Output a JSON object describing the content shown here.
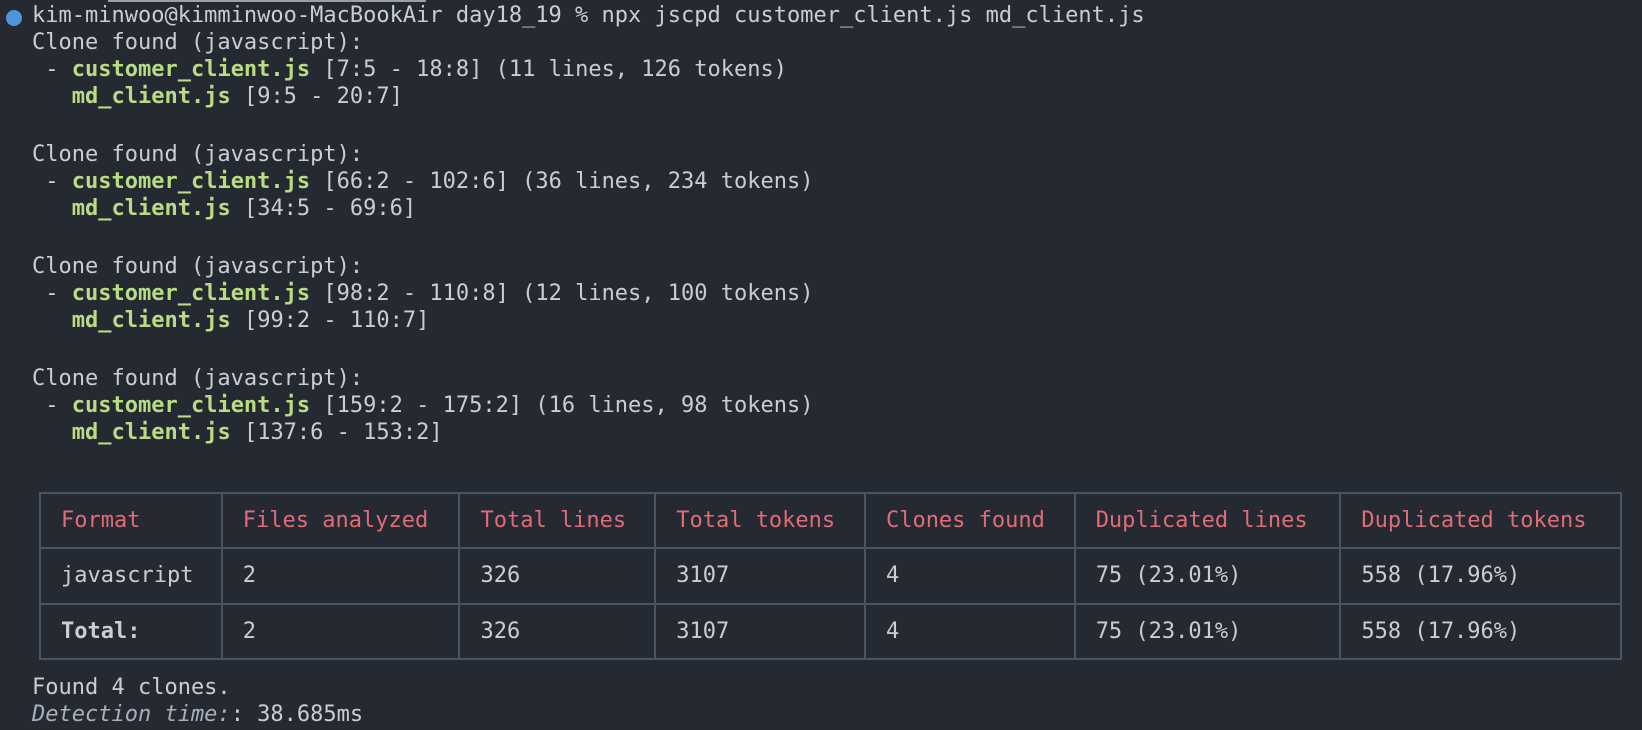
{
  "command": "kim-minwoo@kimminwoo-MacBookAir day18_19 % npx jscpd customer_client.js md_client.js",
  "clones": [
    {
      "header": "Clone found (javascript):",
      "file_a": "customer_client.js",
      "range_a": " [7:5 - 18:8] (11 lines, 126 tokens)",
      "file_b": "md_client.js",
      "range_b": " [9:5 - 20:7]"
    },
    {
      "header": "Clone found (javascript):",
      "file_a": "customer_client.js",
      "range_a": " [66:2 - 102:6] (36 lines, 234 tokens)",
      "file_b": "md_client.js",
      "range_b": " [34:5 - 69:6]"
    },
    {
      "header": "Clone found (javascript):",
      "file_a": "customer_client.js",
      "range_a": " [98:2 - 110:8] (12 lines, 100 tokens)",
      "file_b": "md_client.js",
      "range_b": " [99:2 - 110:7]"
    },
    {
      "header": "Clone found (javascript):",
      "file_a": "customer_client.js",
      "range_a": " [159:2 - 175:2] (16 lines, 98 tokens)",
      "file_b": "md_client.js",
      "range_b": " [137:6 - 153:2]"
    }
  ],
  "dash": " - ",
  "indent": "   ",
  "table": {
    "headers": [
      "Format",
      "Files analyzed",
      "Total lines",
      "Total tokens",
      "Clones found",
      "Duplicated lines",
      "Duplicated tokens"
    ],
    "rows": [
      [
        "javascript",
        "2",
        "326",
        "3107",
        "4",
        "75 (23.01%)",
        "558 (17.96%)"
      ],
      [
        "Total:",
        "2",
        "326",
        "3107",
        "4",
        "75 (23.01%)",
        "558 (17.96%)"
      ]
    ]
  },
  "footer": {
    "found": "Found 4 clones.",
    "detection_label": "Detection time:",
    "detection_value": ": 38.685ms"
  },
  "colors": {
    "background": "#252932",
    "text": "#c9ced6",
    "filename": "#b9dc83",
    "table_header": "#e06c75",
    "border": "#4c5360",
    "prompt_dot": "#4e95d9"
  }
}
